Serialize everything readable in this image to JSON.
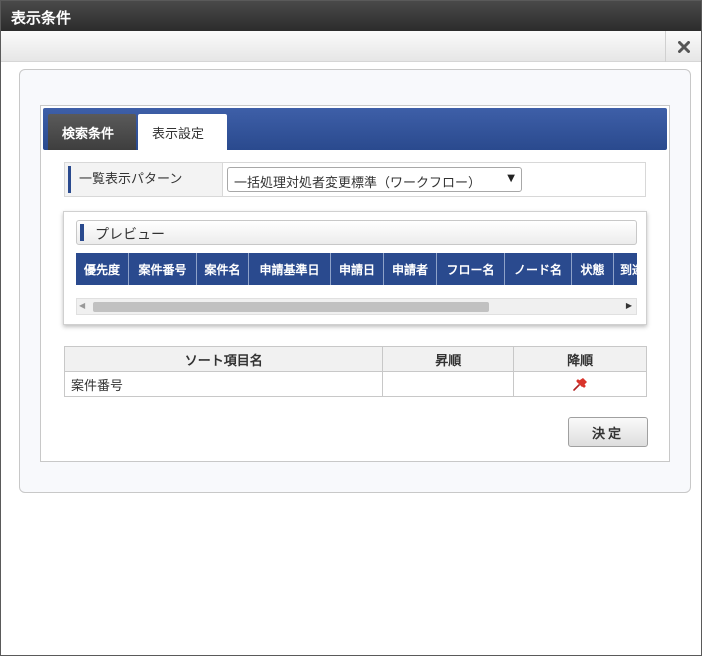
{
  "window": {
    "title": "表示条件"
  },
  "tabs": [
    {
      "label": "検索条件",
      "active": false
    },
    {
      "label": "表示設定",
      "active": true
    }
  ],
  "pattern": {
    "label": "一覧表示パターン",
    "selected": "一括処理対処者変更標準（ワークフロー）"
  },
  "preview": {
    "title": "プレビュー",
    "columns": [
      "優先度",
      "案件番号",
      "案件名",
      "申請基準日",
      "申請日",
      "申請者",
      "フロー名",
      "ノード名",
      "状態",
      "到達日"
    ]
  },
  "sort": {
    "headers": {
      "name": "ソート項目名",
      "asc": "昇順",
      "desc": "降順"
    },
    "rows": [
      {
        "name": "案件番号",
        "asc": "",
        "desc_icon": "pin-icon"
      }
    ]
  },
  "actions": {
    "decide": "決定"
  },
  "colors": {
    "accent": "#2a4a8e",
    "titlebar": "#333333",
    "pin": "#d9342b"
  }
}
